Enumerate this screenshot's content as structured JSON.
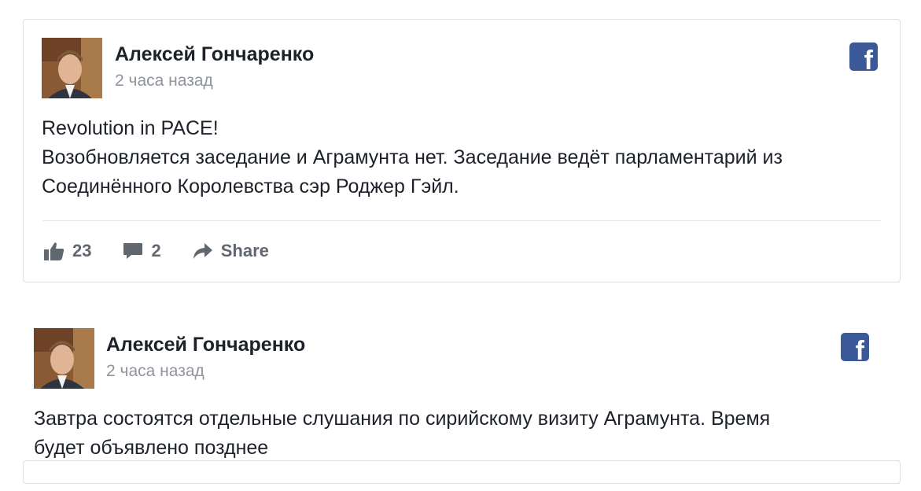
{
  "posts": [
    {
      "author": "Алексей Гончаренко",
      "time": "2 часа назад",
      "lines": [
        "Revolution in PACE!",
        "Возобновляется заседание и Аграмунта нет. Заседание ведёт парламентарий из",
        "Соединённого Королевства сэр Роджер Гэйл."
      ],
      "likes": "23",
      "comments": "2",
      "share_label": "Share",
      "badge_letter": "f"
    },
    {
      "author": "Алексей Гончаренко",
      "time": "2 часа назад",
      "lines": [
        "Завтра состоятся отдельные слушания по сирийскому визиту Аграмунта. Время",
        "будет объявлено позднее"
      ],
      "badge_letter": "f"
    }
  ],
  "colors": {
    "facebook_blue": "#3b5998",
    "text": "#1d2129",
    "muted": "#90949c",
    "action": "#606770"
  },
  "icons": [
    "facebook-icon",
    "like-icon",
    "comment-icon",
    "share-icon"
  ]
}
